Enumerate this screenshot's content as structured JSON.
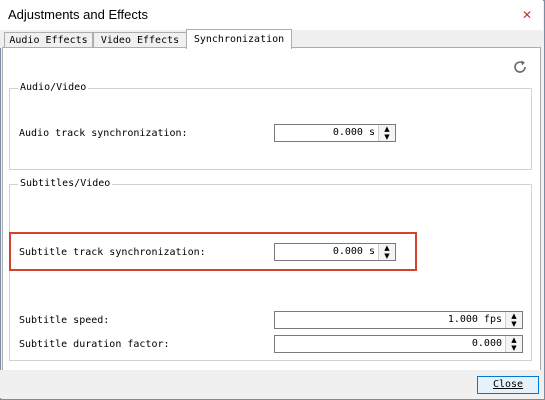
{
  "window": {
    "title": "Adjustments and Effects",
    "close_glyph": "✕"
  },
  "tabs": [
    {
      "label": "Audio Effects",
      "active": false
    },
    {
      "label": "Video Effects",
      "active": false
    },
    {
      "label": "Synchronization",
      "active": true
    }
  ],
  "audio_video": {
    "title": "Audio/Video",
    "audio_sync_label": "Audio track synchronization:",
    "audio_sync_value": "0.000 s"
  },
  "subtitles_video": {
    "title": "Subtitles/Video",
    "subtitle_sync_label": "Subtitle track synchronization:",
    "subtitle_sync_value": "0.000 s",
    "subtitle_speed_label": "Subtitle speed:",
    "subtitle_speed_value": "1.000 fps",
    "subtitle_duration_label": "Subtitle duration factor:",
    "subtitle_duration_value": "0.000"
  },
  "buttons": {
    "close_label": "Close"
  },
  "icons": {
    "reset": "refresh-icon",
    "spin_up": "▲",
    "spin_down": "▼"
  },
  "colors": {
    "highlight": "#d2432f",
    "accent": "#0078d7"
  }
}
